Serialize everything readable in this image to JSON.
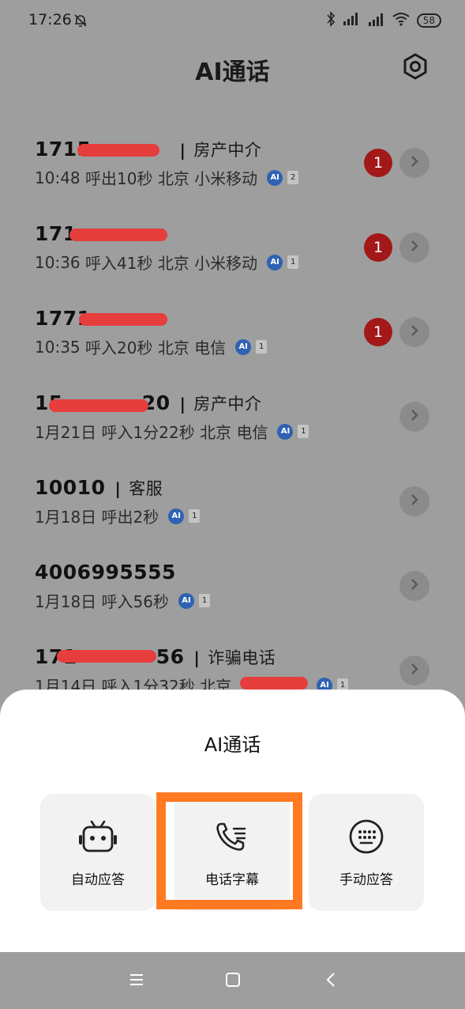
{
  "status_bar": {
    "time": "17:26",
    "battery": "58"
  },
  "header": {
    "title": "AI通话"
  },
  "calls": [
    {
      "number": "1715",
      "tag": "房产中介",
      "time": "10:48",
      "direction": "呼出10秒",
      "city": "北京",
      "carrier": "小米移动",
      "ai": "AI",
      "count": "2",
      "unread": "1"
    },
    {
      "number": "171",
      "tag": "",
      "time": "10:36",
      "direction": "呼入41秒",
      "city": "北京",
      "carrier": "小米移动",
      "ai": "AI",
      "count": "1",
      "unread": "1"
    },
    {
      "number": "1771",
      "tag": "",
      "time": "10:35",
      "direction": "呼入20秒",
      "city": "北京",
      "carrier": "电信",
      "ai": "AI",
      "count": "1",
      "unread": "1"
    },
    {
      "number": "15",
      "number_tail": "20",
      "tag": "房产中介",
      "time": "1月21日",
      "direction": "呼入1分22秒",
      "city": "北京",
      "carrier": "电信",
      "ai": "AI",
      "count": "1"
    },
    {
      "number": "10010",
      "tag": "客服",
      "time": "1月18日",
      "direction": "呼出2秒",
      "city": "",
      "carrier": "",
      "ai": "AI",
      "count": "1"
    },
    {
      "number": "4006995555",
      "tag": "",
      "time": "1月18日",
      "direction": "呼入56秒",
      "city": "",
      "carrier": "",
      "ai": "AI",
      "count": "1"
    },
    {
      "number": "171",
      "number_tail": "56",
      "tag": "诈骗电话",
      "time": "1月14日",
      "direction": "呼入1分32秒",
      "city": "北京",
      "carrier": "",
      "ai": "AI",
      "count": "1"
    }
  ],
  "sheet": {
    "title": "AI通话",
    "options": [
      {
        "label": "自动应答",
        "icon": "robot-icon"
      },
      {
        "label": "电话字幕",
        "icon": "phone-caption-icon"
      },
      {
        "label": "手动应答",
        "icon": "keypad-icon"
      }
    ]
  },
  "colors": {
    "unread_badge": "#a31818",
    "ai_badge": "#2f62b3",
    "highlight": "#ff7a21",
    "redaction": "#e63d3d"
  }
}
